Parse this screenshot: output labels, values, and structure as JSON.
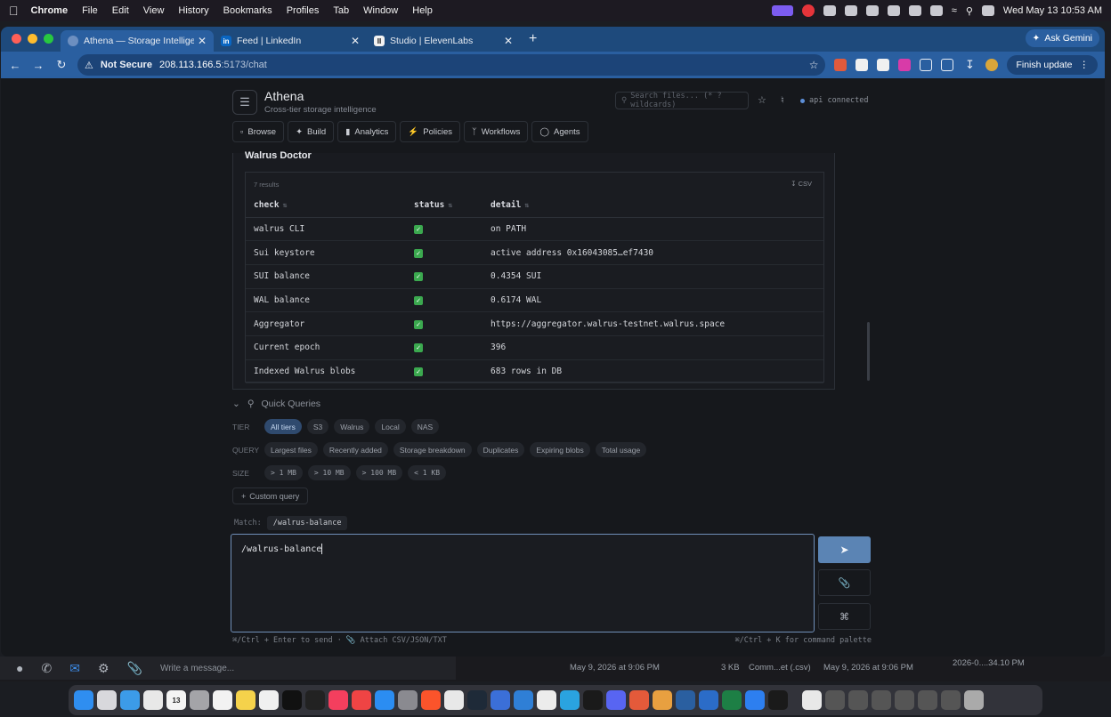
{
  "menubar": {
    "app_name": "Chrome",
    "items": [
      "File",
      "Edit",
      "View",
      "History",
      "Bookmarks",
      "Profiles",
      "Tab",
      "Window",
      "Help"
    ],
    "clock": "Wed May 13  10:53 AM"
  },
  "browser": {
    "tabs": [
      {
        "title": "Athena — Storage Intelligence",
        "favicon": "globe-icon"
      },
      {
        "title": "Feed | LinkedIn",
        "favicon": "in"
      },
      {
        "title": "Studio | ElevenLabs",
        "favicon": "II"
      }
    ],
    "ask_gemini": "Ask Gemini",
    "not_secure": "Not Secure",
    "url_host": "208.113.166.5",
    "url_path": ":5173/chat",
    "finish_update": "Finish update"
  },
  "app": {
    "title": "Athena",
    "subtitle": "Cross-tier storage intelligence",
    "search_placeholder": "Search files... (* ? wildcards)",
    "api_status": "api connected",
    "nav": [
      {
        "label": "Browse",
        "icon": "folder-icon"
      },
      {
        "label": "Build",
        "icon": "wand-icon"
      },
      {
        "label": "Analytics",
        "icon": "bar-chart-icon"
      },
      {
        "label": "Policies",
        "icon": "bolt-icon"
      },
      {
        "label": "Workflows",
        "icon": "branch-icon"
      },
      {
        "label": "Agents",
        "icon": "chat-icon"
      }
    ]
  },
  "doctor": {
    "title": "Walrus Doctor",
    "result_count": "7 results",
    "csv_label": "CSV",
    "columns": [
      "check",
      "status",
      "detail"
    ],
    "rows": [
      {
        "check": "walrus CLI",
        "status": "✓",
        "detail": "on PATH"
      },
      {
        "check": "Sui keystore",
        "status": "✓",
        "detail": "active address 0x16043085…ef7430"
      },
      {
        "check": "SUI balance",
        "status": "✓",
        "detail": "0.4354 SUI"
      },
      {
        "check": "WAL balance",
        "status": "✓",
        "detail": "0.6174 WAL"
      },
      {
        "check": "Aggregator",
        "status": "✓",
        "detail": "https://aggregator.walrus-testnet.walrus.space"
      },
      {
        "check": "Current epoch",
        "status": "✓",
        "detail": "396"
      },
      {
        "check": "Indexed Walrus blobs",
        "status": "✓",
        "detail": "683 rows in DB"
      }
    ]
  },
  "quick_queries": {
    "title": "Quick Queries",
    "tier_label": "TIER",
    "tiers": [
      "All tiers",
      "S3",
      "Walrus",
      "Local",
      "NAS"
    ],
    "query_label": "QUERY",
    "queries": [
      "Largest files",
      "Recently added",
      "Storage breakdown",
      "Duplicates",
      "Expiring blobs",
      "Total usage"
    ],
    "size_label": "SIZE",
    "sizes": [
      "> 1 MB",
      "> 10 MB",
      "> 100 MB",
      "< 1 KB"
    ],
    "custom_label": "Custom query"
  },
  "composer": {
    "match_label": "Match:",
    "match_value": "/walrus-balance",
    "input_value": "/walrus-balance",
    "hint_left": "⌘/Ctrl + Enter to send · 📎 Attach CSV/JSON/TXT",
    "hint_right": "⌘/Ctrl + K for command palette",
    "cmd_symbol": "⌘"
  },
  "background": {
    "message_placeholder": "Write a message...",
    "finder_date1": "May 9, 2026 at 9:06 PM",
    "finder_size": "3 KB",
    "finder_kind": "Comm...et (.csv)",
    "finder_date2": "May 9, 2026 at 9:06 PM",
    "finder_name": "2026-0....34.10 PM"
  },
  "colors": {
    "tab_bar": "#1e4a7c",
    "toolbar": "#2a5fa0",
    "accent": "#5b84b4",
    "status_ok": "#3ba94f"
  }
}
